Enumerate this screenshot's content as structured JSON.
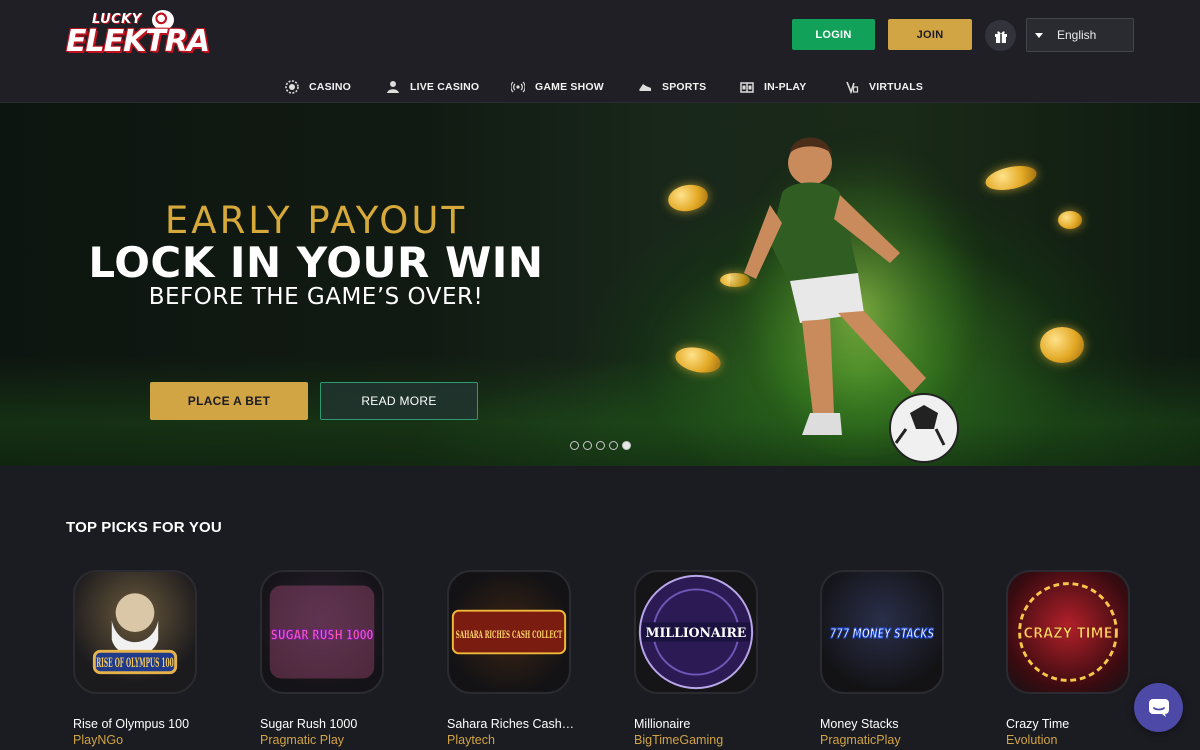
{
  "brand": {
    "logo_top": "LUCKY",
    "logo_main": "ELEKTRA"
  },
  "header": {
    "login_label": "LOGIN",
    "join_label": "JOIN",
    "language": "English",
    "colors": {
      "login": "#12a158",
      "join": "#d1a444"
    }
  },
  "nav": {
    "items": [
      {
        "label": "CASINO",
        "icon": "chip-icon"
      },
      {
        "label": "LIVE CASINO",
        "icon": "dealer-icon"
      },
      {
        "label": "GAME SHOW",
        "icon": "broadcast-icon"
      },
      {
        "label": "SPORTS",
        "icon": "shoe-icon"
      },
      {
        "label": "IN-PLAY",
        "icon": "scoreboard-icon"
      },
      {
        "label": "VIRTUALS",
        "icon": "virtual-icon"
      }
    ]
  },
  "hero": {
    "line1": "EARLY PAYOUT",
    "line2": "LOCK IN YOUR WIN",
    "line3": "BEFORE THE GAME’S OVER!",
    "primary_cta": "PLACE A BET",
    "secondary_cta": "READ MORE",
    "slides_total": 5,
    "active_slide": 5
  },
  "section": {
    "title": "TOP PICKS FOR YOU",
    "games": [
      {
        "art": "RISE OF OLYMPUS 100",
        "name": "Rise of Olympus 100",
        "provider": "PlayNGo"
      },
      {
        "art": "SUGAR RUSH 1000",
        "name": "Sugar Rush 1000",
        "provider": "Pragmatic Play"
      },
      {
        "art": "SAHARA RICHES CASH COLLECT",
        "name": "Sahara Riches Cash Collect",
        "provider": "Playtech"
      },
      {
        "art": "MILLIONAIRE",
        "name": "Millionaire",
        "provider": "BigTimeGaming"
      },
      {
        "art": "777 MONEY STACKS",
        "name": "Money Stacks",
        "provider": "PragmaticPlay"
      },
      {
        "art": "CRAZY TIME",
        "name": "Crazy Time",
        "provider": "Evolution"
      }
    ]
  }
}
